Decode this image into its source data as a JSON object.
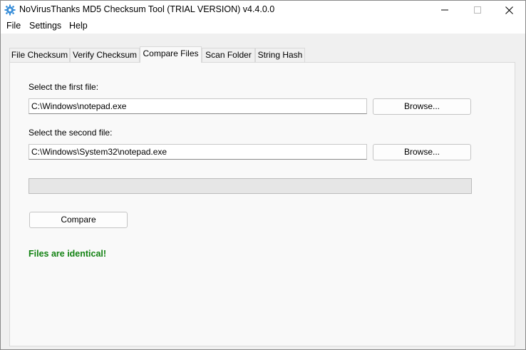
{
  "window": {
    "title": "NoVirusThanks MD5 Checksum Tool (TRIAL VERSION) v4.4.0.0"
  },
  "menu": {
    "file": "File",
    "settings": "Settings",
    "help": "Help"
  },
  "tabs": [
    {
      "label": "File Checksum",
      "active": false
    },
    {
      "label": "Verify Checksum",
      "active": false
    },
    {
      "label": "Compare Files",
      "active": true
    },
    {
      "label": "Scan Folder",
      "active": false
    },
    {
      "label": "String Hash",
      "active": false
    }
  ],
  "compare": {
    "first_label": "Select the first file:",
    "first_value": "C:\\Windows\\notepad.exe",
    "second_label": "Select the second file:",
    "second_value": "C:\\Windows\\System32\\notepad.exe",
    "browse_label": "Browse...",
    "compare_label": "Compare",
    "progress_percent": 0,
    "result_text": "Files are identical!",
    "result_color": "#128212"
  }
}
